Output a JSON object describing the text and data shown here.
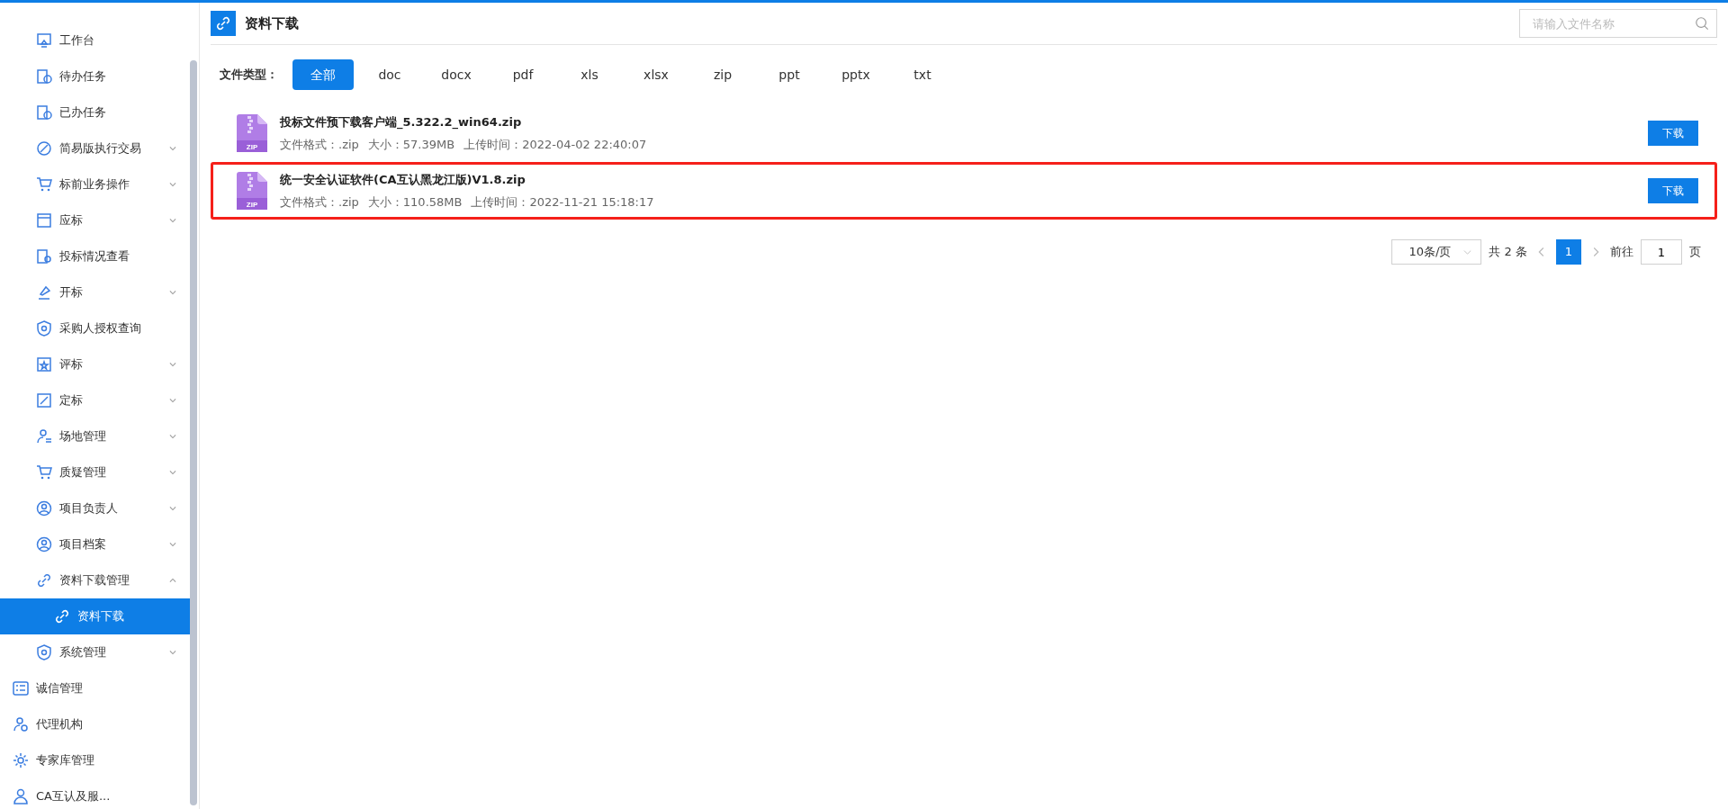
{
  "sidebar": {
    "sub_items": [
      {
        "label": "工作台"
      },
      {
        "label": "待办任务"
      },
      {
        "label": "已办任务"
      },
      {
        "label": "简易版执行交易",
        "expanded": false
      },
      {
        "label": "标前业务操作",
        "expanded": false
      },
      {
        "label": "应标",
        "expanded": false
      },
      {
        "label": "投标情况查看"
      },
      {
        "label": "开标",
        "expanded": false
      },
      {
        "label": "采购人授权查询"
      },
      {
        "label": "评标",
        "expanded": false
      },
      {
        "label": "定标",
        "expanded": false
      },
      {
        "label": "场地管理",
        "expanded": false
      },
      {
        "label": "质疑管理",
        "expanded": false
      },
      {
        "label": "项目负责人",
        "expanded": false
      },
      {
        "label": "项目档案",
        "expanded": false
      },
      {
        "label": "资料下载管理",
        "expanded": true,
        "children": [
          {
            "label": "资料下载",
            "selected": true
          }
        ]
      },
      {
        "label": "系统管理",
        "expanded": false
      }
    ],
    "items": [
      {
        "label": "诚信管理"
      },
      {
        "label": "代理机构"
      },
      {
        "label": "专家库管理"
      },
      {
        "label": "CA互认及服..."
      }
    ]
  },
  "header": {
    "title": "资料下载",
    "search": {
      "placeholder": "请输入文件名称"
    }
  },
  "filter": {
    "label": "文件类型：",
    "options": [
      {
        "label": "全部",
        "selected": true
      },
      {
        "label": "doc",
        "selected": false
      },
      {
        "label": "docx",
        "selected": false
      },
      {
        "label": "pdf",
        "selected": false
      },
      {
        "label": "xls",
        "selected": false
      },
      {
        "label": "xlsx",
        "selected": false
      },
      {
        "label": "zip",
        "selected": false
      },
      {
        "label": "ppt",
        "selected": false
      },
      {
        "label": "pptx",
        "selected": false
      },
      {
        "label": "txt",
        "selected": false
      }
    ]
  },
  "files": [
    {
      "icon_label": "ZIP",
      "name": "投标文件预下载客户端_5.322.2_win64.zip",
      "format_label": "文件格式：",
      "format": ".zip",
      "size_label": "大小：",
      "size": "57.39MB",
      "time_label": "上传时间：",
      "time": "2022-04-02 22:40:07",
      "button": "下载",
      "highlighted": false
    },
    {
      "icon_label": "ZIP",
      "name": "统一安全认证软件(CA互认黑龙江版)V1.8.zip",
      "format_label": "文件格式：",
      "format": ".zip",
      "size_label": "大小：",
      "size": "110.58MB",
      "time_label": "上传时间：",
      "time": "2022-11-21 15:18:17",
      "button": "下载",
      "highlighted": true
    }
  ],
  "pagination": {
    "page_size": "10条/页",
    "total": "共 2 条",
    "pages": [
      {
        "label": "1",
        "selected": true
      }
    ],
    "goto_label": "前往",
    "goto_value": "1",
    "page_suffix": "页"
  }
}
